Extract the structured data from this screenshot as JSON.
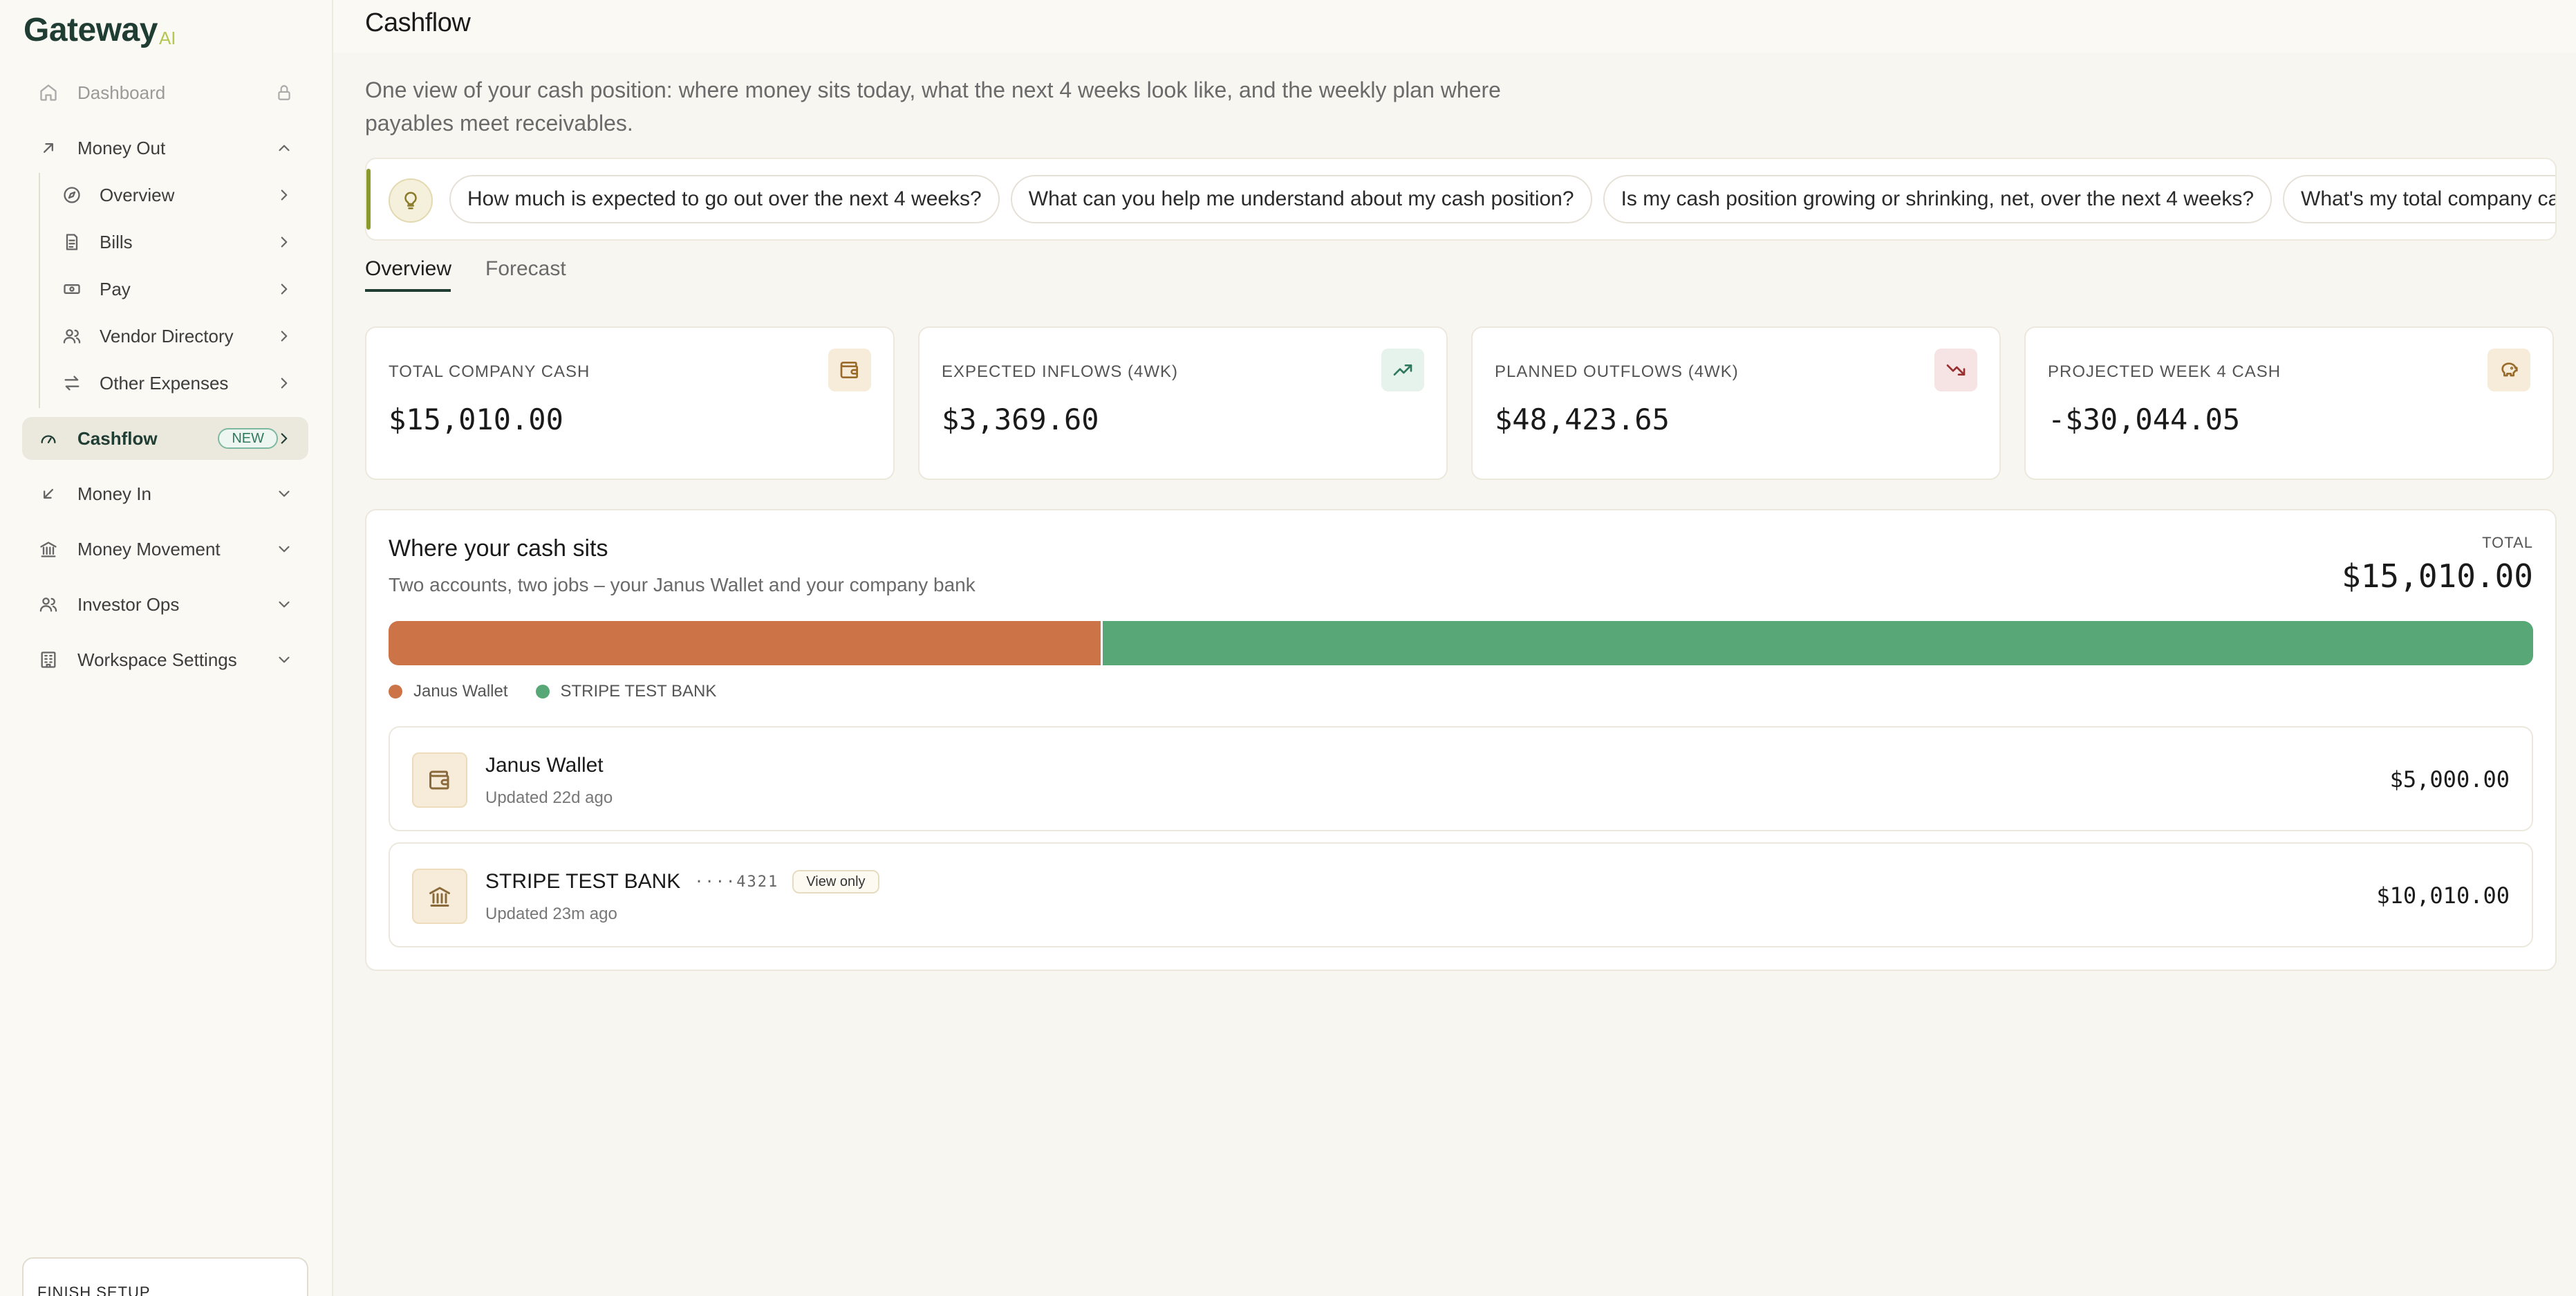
{
  "brand": {
    "name": "Gateway",
    "suffix": "AI"
  },
  "sidebar": {
    "items": [
      {
        "label": "Dashboard",
        "icon": "home-icon",
        "trailing": "lock-icon"
      },
      {
        "label": "Money Out",
        "icon": "arrow-up-right-icon",
        "trailing": "chevron-up-icon"
      },
      {
        "label": "Overview",
        "icon": "compass-icon",
        "trailing": "chevron-right-icon"
      },
      {
        "label": "Bills",
        "icon": "document-icon",
        "trailing": "chevron-right-icon"
      },
      {
        "label": "Pay",
        "icon": "cash-icon",
        "trailing": "chevron-right-icon"
      },
      {
        "label": "Vendor Directory",
        "icon": "users-icon",
        "trailing": "chevron-right-icon"
      },
      {
        "label": "Other Expenses",
        "icon": "swap-icon",
        "trailing": "chevron-right-icon"
      },
      {
        "label": "Cashflow",
        "icon": "gauge-icon",
        "badge": "NEW",
        "trailing": "chevron-right-icon"
      },
      {
        "label": "Money In",
        "icon": "arrow-down-left-icon",
        "trailing": "chevron-down-icon"
      },
      {
        "label": "Money Movement",
        "icon": "bank-icon",
        "trailing": "chevron-down-icon"
      },
      {
        "label": "Investor Ops",
        "icon": "users-icon",
        "trailing": "chevron-down-icon"
      },
      {
        "label": "Workspace Settings",
        "icon": "building-icon",
        "trailing": "chevron-down-icon"
      }
    ],
    "setup_label": "FINISH SETUP"
  },
  "page": {
    "title": "Cashflow",
    "intro": "One view of your cash position: where money sits today, what the next 4 weeks look like, and the weekly plan where payables meet receivables."
  },
  "suggestions": [
    "How much is expected to go out over the next 4 weeks?",
    "What can you help me understand about my cash position?",
    "Is my cash position growing or shrinking, net, over the next 4 weeks?",
    "What's my total company cash"
  ],
  "tabs": {
    "overview": "Overview",
    "forecast": "Forecast"
  },
  "stats": [
    {
      "label": "TOTAL COMPANY CASH",
      "value": "$15,010.00",
      "icon": "wallet-icon",
      "icon_bg": "#f6ecd9",
      "icon_color": "#9a6a2a"
    },
    {
      "label": "EXPECTED INFLOWS (4WK)",
      "value": "$3,369.60",
      "icon": "trending-up-icon",
      "icon_bg": "#e6f2ec",
      "icon_color": "#2f7a5d"
    },
    {
      "label": "PLANNED OUTFLOWS (4WK)",
      "value": "$48,423.65",
      "icon": "trending-down-icon",
      "icon_bg": "#f6e3e3",
      "icon_color": "#9a2f2f"
    },
    {
      "label": "PROJECTED WEEK 4 CASH",
      "value": "-$30,044.05",
      "icon": "piggy-bank-icon",
      "icon_bg": "#f6ecd9",
      "icon_color": "#9a6a2a"
    }
  ],
  "cash_sits": {
    "title": "Where your cash sits",
    "subtitle": "Two accounts, two jobs – your Janus Wallet and your company bank",
    "total_label": "TOTAL",
    "total": "$15,010.00",
    "segments": [
      {
        "name": "Janus Wallet",
        "amount": 5000.0,
        "color": "#cc7448"
      },
      {
        "name": "STRIPE TEST BANK",
        "amount": 10010.0,
        "color": "#58a777"
      }
    ],
    "accounts": [
      {
        "name": "Janus Wallet",
        "updated": "Updated 22d ago",
        "amount": "$5,000.00",
        "icon": "wallet-icon"
      },
      {
        "name": "STRIPE TEST BANK",
        "mask": "····4321",
        "tag": "View only",
        "updated": "Updated 23m ago",
        "amount": "$10,010.00",
        "icon": "bank-icon"
      }
    ]
  }
}
